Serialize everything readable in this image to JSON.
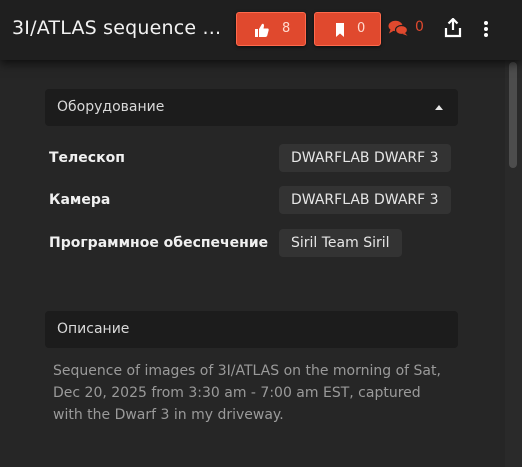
{
  "header": {
    "title": "3I/ATLAS sequence ...",
    "likes": "8",
    "bookmarks": "0",
    "comments": "0",
    "accent_color": "#e0492e",
    "icons": [
      "thumbs-up-icon",
      "bookmark-icon",
      "comments-icon",
      "share-icon",
      "more-vertical-icon"
    ]
  },
  "equipment": {
    "section_title": "Оборудование",
    "rows": [
      {
        "label": "Телескоп",
        "value": "DWARFLAB DWARF 3"
      },
      {
        "label": "Камера",
        "value": "DWARFLAB DWARF 3"
      },
      {
        "label": "Программное обеспечение",
        "value": "Siril Team Siril"
      }
    ]
  },
  "description": {
    "section_title": "Описание",
    "text": "Sequence of images of 3I/ATLAS on the morning of Sat, Dec 20, 2025 from 3:30 am - 7:00 am EST, captured with the Dwarf 3 in my driveway."
  }
}
